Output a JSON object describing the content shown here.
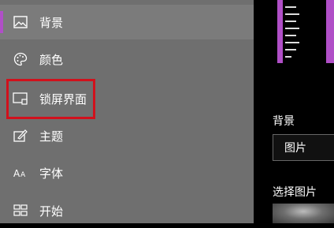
{
  "sidebar": {
    "items": [
      {
        "label": "背景",
        "icon": "picture-icon",
        "selected": true
      },
      {
        "label": "颜色",
        "icon": "palette-icon",
        "selected": false
      },
      {
        "label": "锁屏界面",
        "icon": "lockscreen-icon",
        "selected": false
      },
      {
        "label": "主题",
        "icon": "theme-brush-icon",
        "selected": false
      },
      {
        "label": "字体",
        "icon": "font-icon",
        "selected": false
      },
      {
        "label": "开始",
        "icon": "start-grid-icon",
        "selected": false
      }
    ]
  },
  "main": {
    "background_label": "背景",
    "background_value": "图片",
    "choose_picture_label": "选择图片"
  },
  "colors": {
    "accent": "#b04fc7",
    "highlight_border": "#d1111c",
    "sidebar_bg": "#6f6f6f"
  }
}
